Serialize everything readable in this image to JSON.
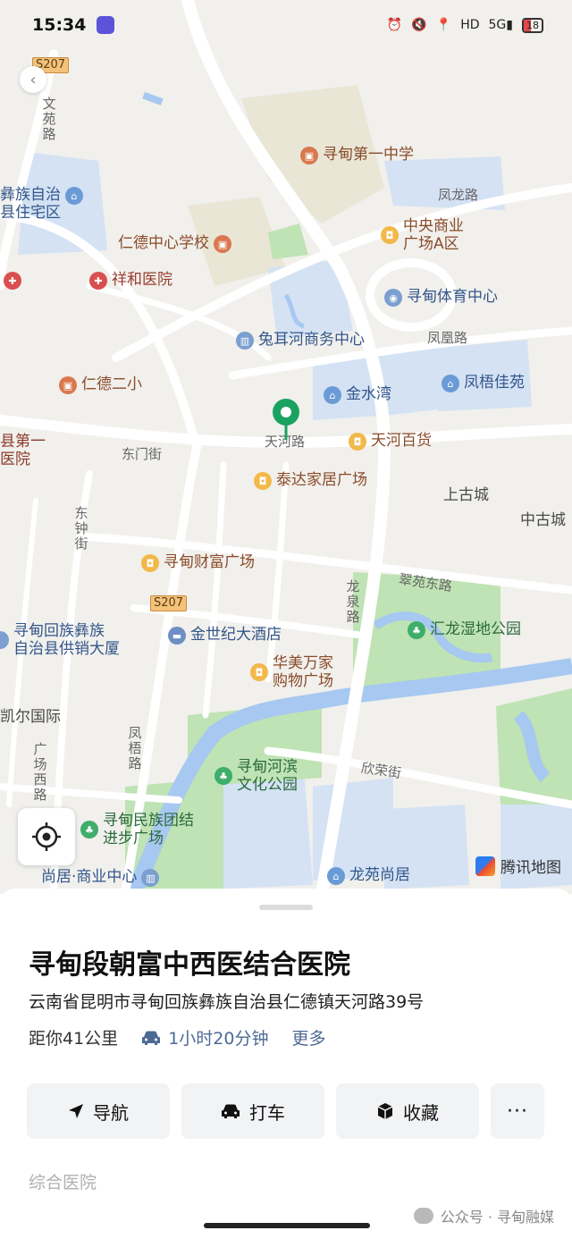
{
  "status_bar": {
    "time": "15:34",
    "network_label": "HD",
    "signal_label": "5G",
    "battery_level": "18",
    "icons": [
      "alarm-icon",
      "mute-icon",
      "location-icon",
      "hd-icon",
      "signal-icon",
      "battery-icon"
    ]
  },
  "map": {
    "provider_label": "腾讯地图",
    "route_shields": [
      "S207",
      "S207"
    ],
    "road_labels": {
      "wenyuan": "文苑路",
      "fenglong": "凤龙路",
      "fenghuang": "凤凰路",
      "tianhe": "天河路",
      "dongmen": "东门街",
      "dongzhong": "东钟街",
      "cuiyuan_east": "翠苑东路",
      "longquan": "龙泉路",
      "fengwu": "凤梧路",
      "guangchang_west": "广场西路",
      "xinrong": "欣荣街"
    },
    "area_labels": {
      "shanggu": "上古城",
      "zhonggu": "中古城",
      "kaier": "凯尔国际",
      "county_hosp": "县第一医院",
      "county_hosp_line1": "县第一",
      "county_hosp_line2": "医院",
      "yizu_1": "彝族自治",
      "yizu_2": "县住宅区"
    },
    "pois": {
      "no1_middle": "寻甸第一中学",
      "zhongyang_1": "中央商业",
      "zhongyang_2": "广场A区",
      "rende_primary": "仁德中心学校",
      "xianghe": "祥和医院",
      "sports": "寻甸体育中心",
      "tuerhe": "兔耳河商务中心",
      "rende_no2": "仁德二小",
      "jinshuiwan": "金水湾",
      "fengwu_jiayuan": "凤梧佳苑",
      "tianhe_store": "天河百货",
      "taida": "泰达家居广场",
      "caifu": "寻甸财富广场",
      "gongxiao_1": "寻甸回族彝族",
      "gongxiao_2": "自治县供销大厦",
      "jinshiji": "金世纪大酒店",
      "huamei_1": "华美万家",
      "huamei_2": "购物广场",
      "huilong": "汇龙湿地公园",
      "hebin_1": "寻甸河滨",
      "hebin_2": "文化公园",
      "minzu_1": "寻甸民族团结",
      "minzu_2": "进步广场",
      "shangju": "尚居·商业中心",
      "longyuan": "龙苑尚居"
    },
    "selected_pin_color": "#1aa260"
  },
  "place": {
    "name": "寻甸段朝富中西医结合医院",
    "address": "云南省昆明市寻甸回族彝族自治县仁德镇天河路39号",
    "distance": "距你41公里",
    "drive_time": "1小时20分钟",
    "more_label": "更多",
    "category": "综合医院"
  },
  "actions": {
    "navigate": "导航",
    "taxi": "打车",
    "favorite": "收藏",
    "more": "···"
  },
  "watermark": {
    "text": "公众号 · 寻甸融媒"
  },
  "colors": {
    "accent_blue": "#4d6a95",
    "water": "#a7c8f0",
    "park": "#bfe3b4",
    "pin": "#1aa260"
  }
}
